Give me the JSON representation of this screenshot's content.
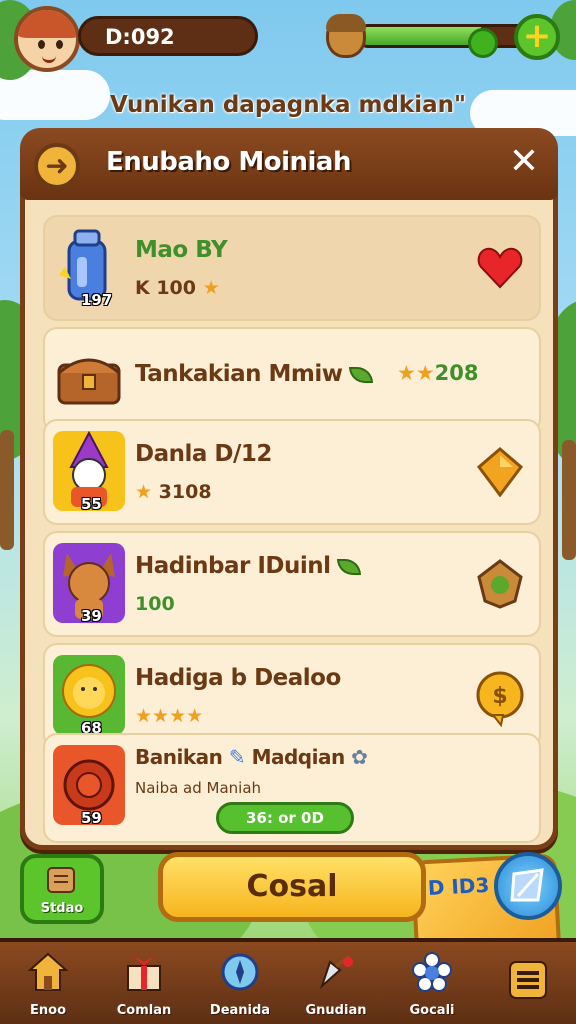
{
  "top_bar": {
    "currency_value": "D:092",
    "energy_level": 0.72
  },
  "headline": "Vunikan dapagnka mdkian\"",
  "panel": {
    "title": "Enubaho Moiniah",
    "close_label": "✕",
    "items": [
      {
        "title": "Mao BY",
        "subtitle": "K 100",
        "level": "197",
        "badge": "heart-icon"
      },
      {
        "title": "Tankakian Mmiw",
        "subtitle": "",
        "reward": "208",
        "badge": "star-icon"
      },
      {
        "title": "Danla D/12",
        "subtitle": "3108",
        "level": "55",
        "badge": "gem-icon"
      },
      {
        "title": "Hadinbar IDuinl",
        "subtitle": "100",
        "level": "39",
        "badge": "acorn-icon"
      },
      {
        "title": "Hadiga b Dealoo",
        "subtitle": "",
        "level": "68",
        "badge": "coin-icon"
      },
      {
        "title": "Banikan",
        "title2": "Madqian",
        "tag": "D ID3",
        "subtitle": "Naiba ad Maniah",
        "level": "59",
        "button": "36: or 0D"
      }
    ]
  },
  "actions": {
    "left_label": "Stdao",
    "main_label": "Cosal"
  },
  "navbar": {
    "items": [
      {
        "label": "Enoo",
        "icon": "home-icon"
      },
      {
        "label": "Comlan",
        "icon": "gift-box-icon"
      },
      {
        "label": "Deanida",
        "icon": "compass-icon"
      },
      {
        "label": "Gnudian",
        "icon": "shovel-icon"
      },
      {
        "label": "Gocali",
        "icon": "flower-icon"
      },
      {
        "label": "",
        "icon": "menu-icon"
      }
    ]
  },
  "colors": {
    "wood": "#7a3e17",
    "parchment": "#f5e2bd",
    "title_text": "#6b3a14",
    "green": "#5cc52c",
    "gold": "#f7b51e"
  }
}
